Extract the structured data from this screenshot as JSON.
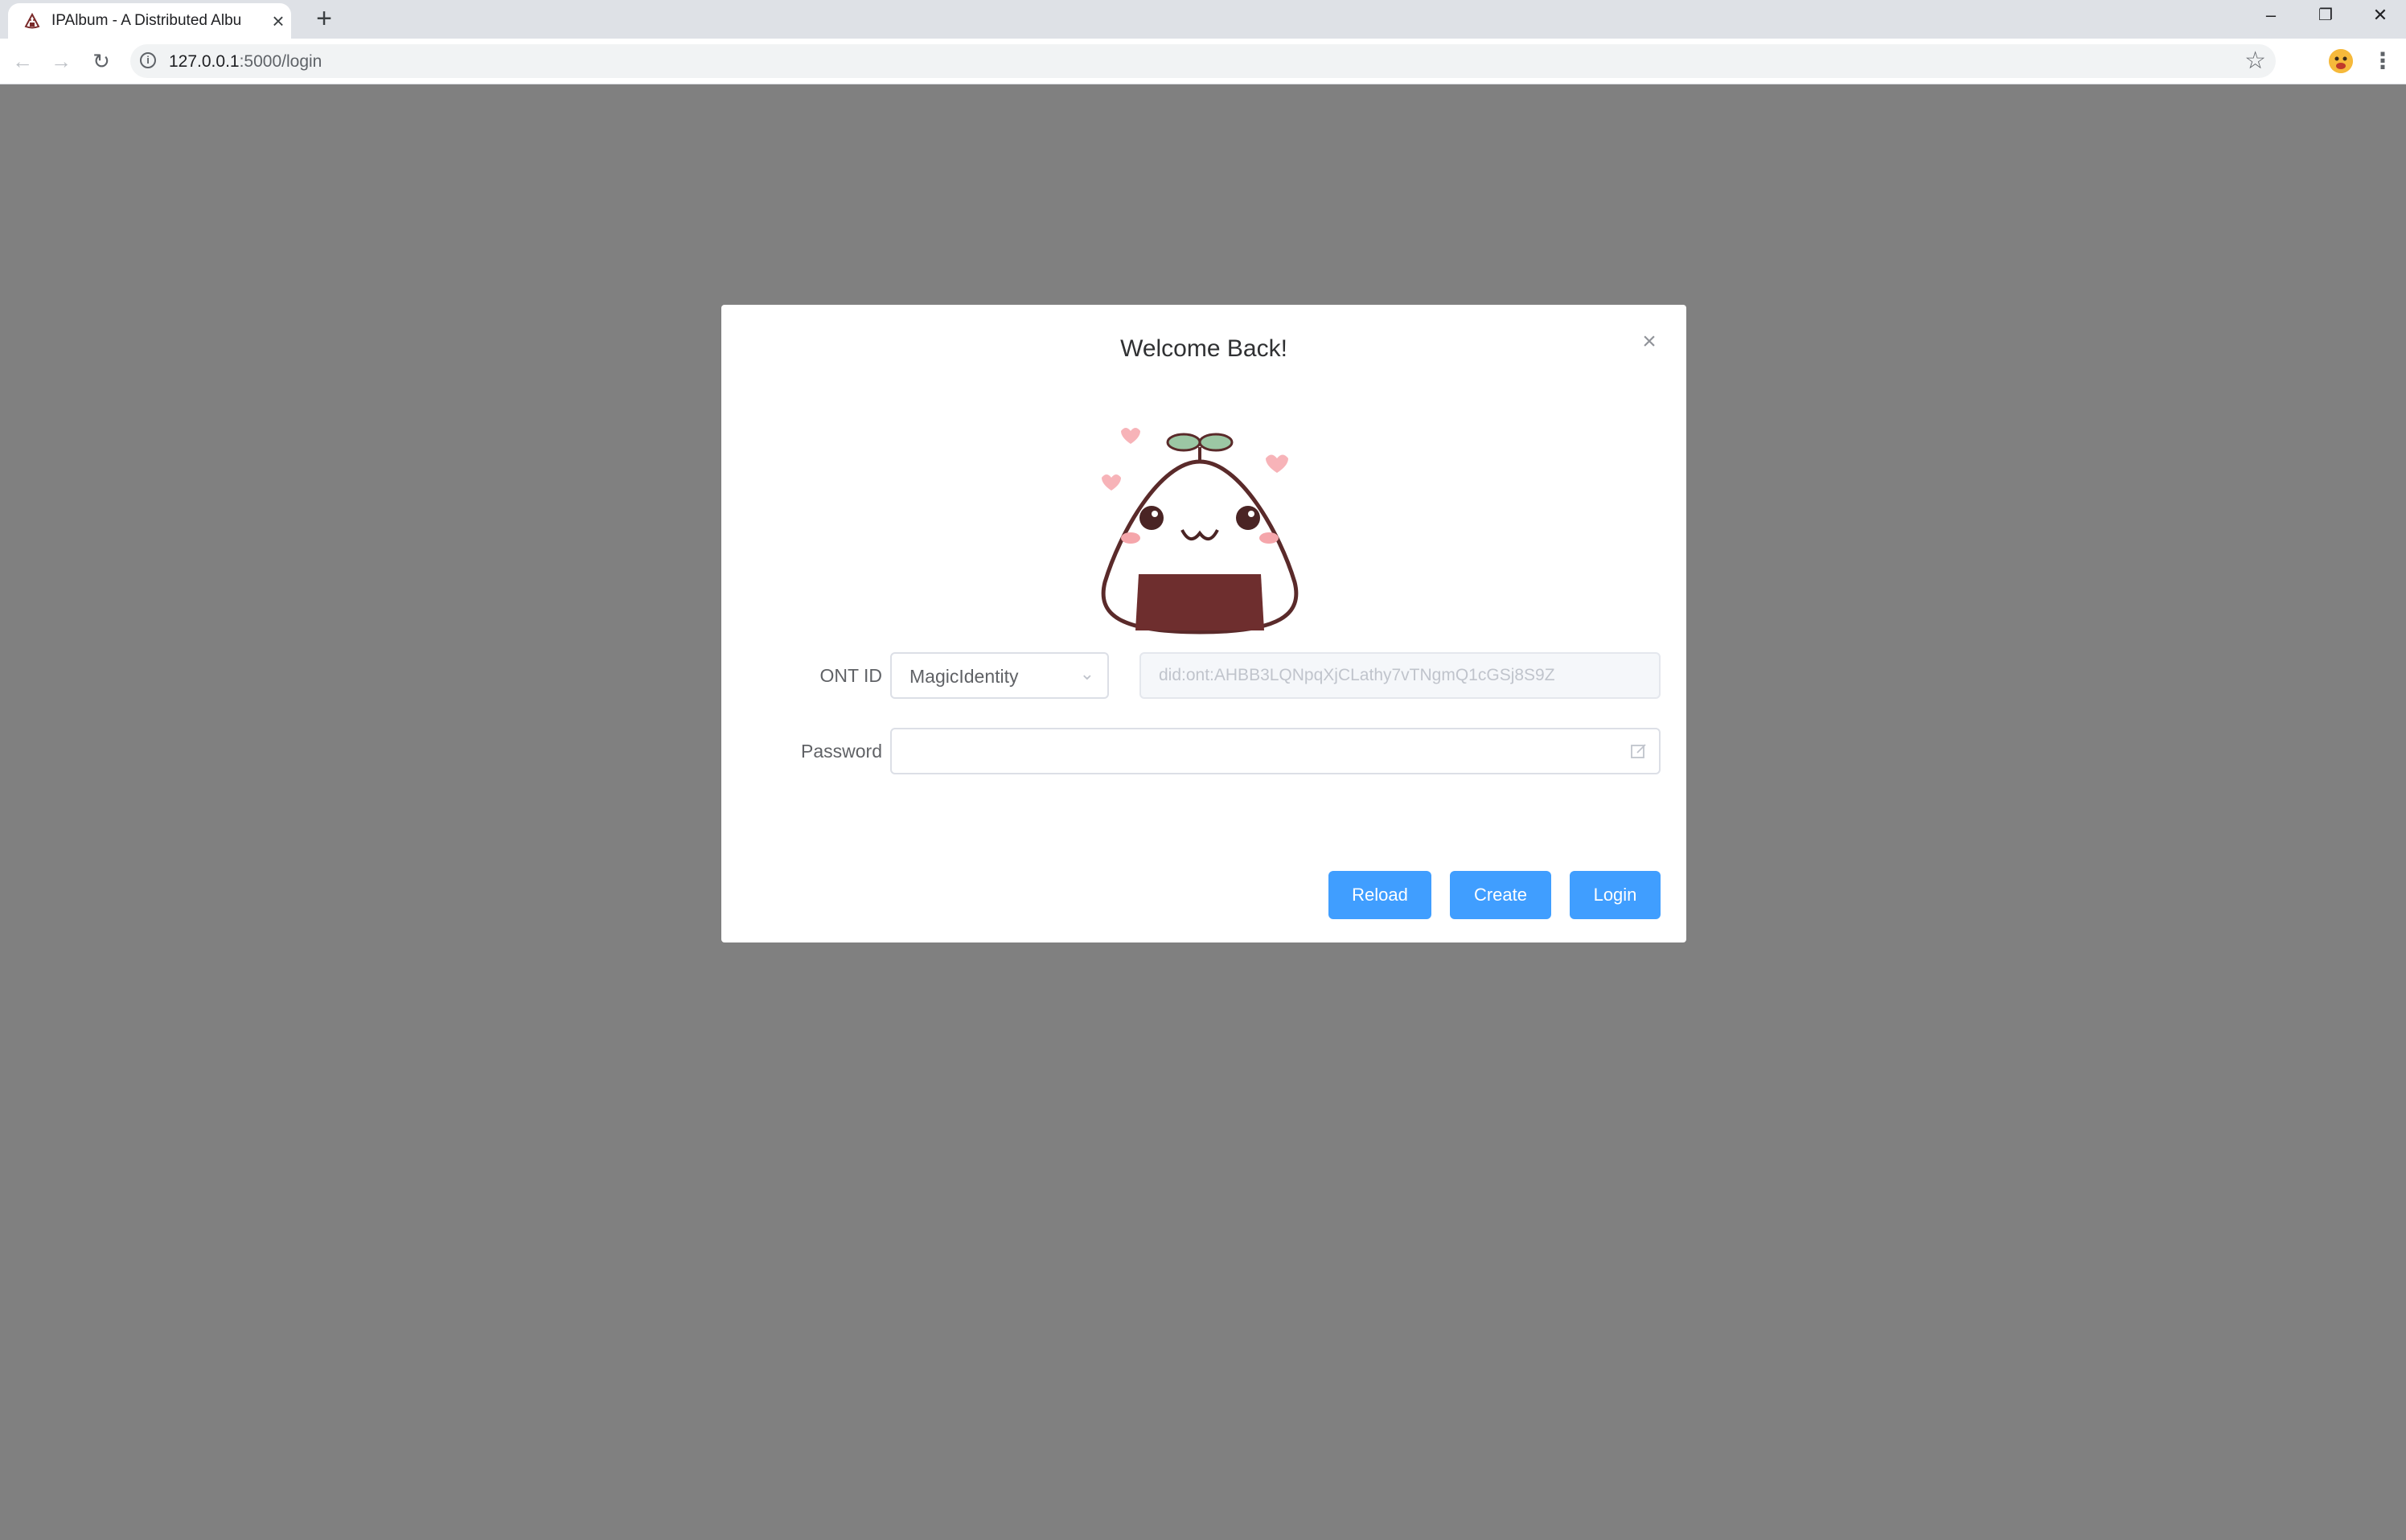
{
  "browser": {
    "tab_title": "IPAlbum - A Distributed Albu",
    "tab_close": "×",
    "new_tab": "+",
    "url_host": "127.0.0.1",
    "url_path": ":5000/login",
    "window_controls": [
      "–",
      "❐",
      "✕"
    ]
  },
  "modal": {
    "title": "Welcome Back!",
    "close_label": "×",
    "ont_id_label": "ONT ID",
    "ont_id_select_value": "MagicIdentity",
    "ont_id_address": "did:ont:AHBB3LQNpqXjCLathy7vTNgmQ1cGSj8S9Z",
    "password_label": "Password",
    "password_value": "",
    "buttons": {
      "reload": "Reload",
      "create": "Create",
      "login": "Login"
    }
  },
  "colors": {
    "overlay": "#808080",
    "primary": "#409eff"
  }
}
